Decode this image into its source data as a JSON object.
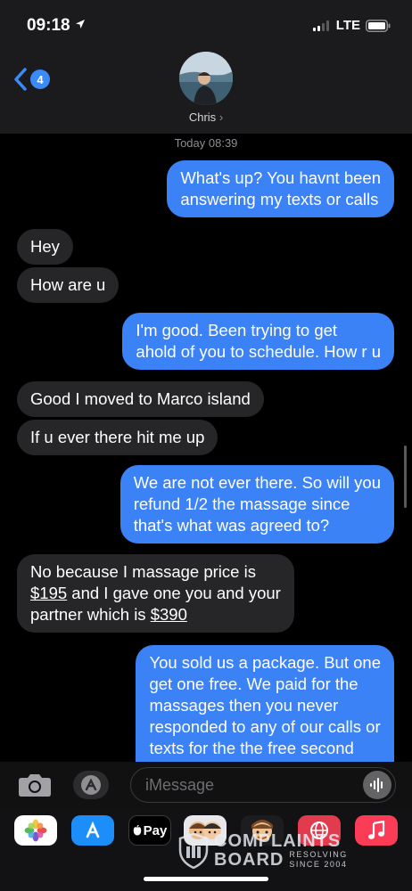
{
  "status": {
    "time": "09:18",
    "network": "LTE"
  },
  "nav": {
    "back_count": "4",
    "contact_name": "Chris",
    "contact_chevron": "›"
  },
  "timestamp": "Today 08:39",
  "messages": [
    {
      "from": "me",
      "lines": [
        "What's up? You havnt been",
        "answering my texts or calls"
      ]
    },
    {
      "from": "them",
      "lines": [
        "Hey"
      ]
    },
    {
      "from": "them",
      "lines": [
        "How are u"
      ]
    },
    {
      "from": "me",
      "lines": [
        "I'm good. Been trying to get",
        "ahold of you to schedule. How r u"
      ]
    },
    {
      "from": "them",
      "lines": [
        "Good I moved to Marco island"
      ]
    },
    {
      "from": "them",
      "lines": [
        "If u ever there hit me up"
      ]
    },
    {
      "from": "me",
      "lines": [
        "We are not ever there. So will you",
        "refund 1/2 the massage since",
        "that's what was agreed to?"
      ]
    },
    {
      "from": "them",
      "lines": [
        "No because I massage price is",
        "$195",
        " and I gave one you and your",
        "partner which is ",
        "$390"
      ]
    },
    {
      "from": "me",
      "lines": [
        "You sold us a package. But one",
        "get one free. We paid for the",
        "massages then you never",
        "responded to any of our calls or",
        "texts for the the free second"
      ]
    }
  ],
  "input": {
    "placeholder": "iMessage"
  },
  "app_strip": {
    "icons": [
      "photos-icon",
      "app-store-icon",
      "apple-pay-icon",
      "memoji-icon",
      "memoji-2-icon",
      "globe-icon",
      "music-icon"
    ],
    "apple_pay_label": "Pay"
  },
  "watermark": {
    "line1": "COMPLAINTS",
    "line2": "BOARD",
    "tagline1": "RESOLVING",
    "tagline2": "SINCE 2004"
  },
  "colors": {
    "outgoing": "#3b82f6",
    "incoming": "#262628",
    "accent": "#3a8bf7"
  }
}
